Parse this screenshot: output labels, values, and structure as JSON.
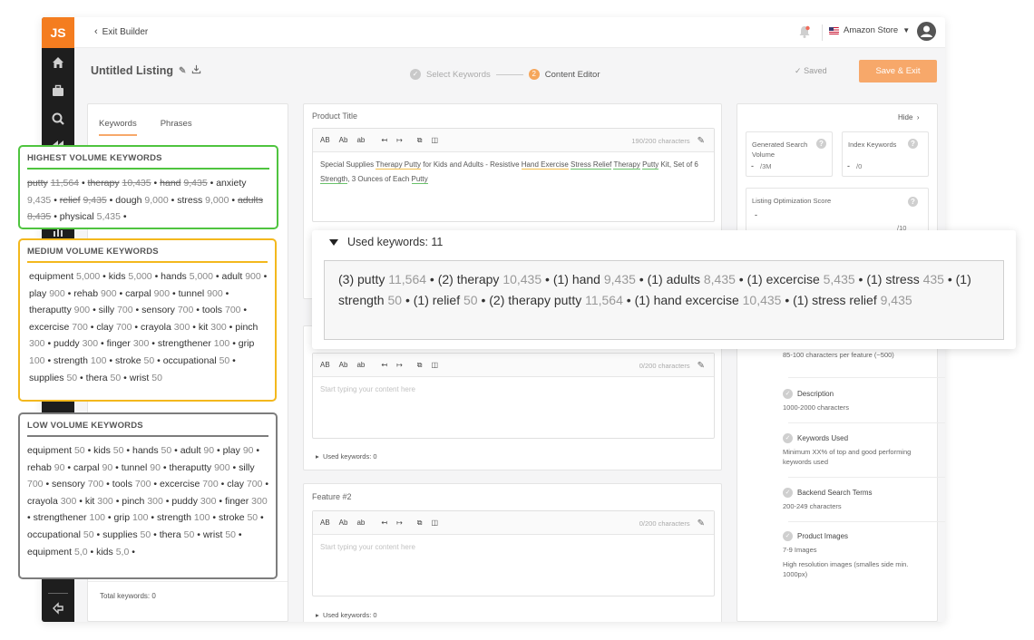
{
  "logo": "JS",
  "topbar": {
    "exit_label": "Exit Builder",
    "store_label": "Amazon Store"
  },
  "header": {
    "listing_title": "Untitled Listing",
    "step1_label": "Select Keywords",
    "step2_number": "2",
    "step2_label": "Content Editor",
    "saved_label": "Saved",
    "save_exit_label": "Save & Exit"
  },
  "left_panel": {
    "tab_keywords": "Keywords",
    "tab_phrases": "Phrases",
    "total_keywords": "Total keywords: 0"
  },
  "editor": {
    "product_title_label": "Product Title",
    "format_buttons": [
      "AB",
      "Ab",
      "ab"
    ],
    "product_title_counter": "190/200 characters",
    "product_title_text": [
      {
        "t": "Special Supplies ",
        "u": ""
      },
      {
        "t": "Therapy Putty",
        "u": "y"
      },
      {
        "t": " for Kids and Adults - Resistive ",
        "u": ""
      },
      {
        "t": "Hand Exercise",
        "u": "y"
      },
      {
        "t": " ",
        "u": ""
      },
      {
        "t": "Stress Relief",
        "u": "g"
      },
      {
        "t": " ",
        "u": ""
      },
      {
        "t": "Therapy",
        "u": "g"
      },
      {
        "t": " ",
        "u": ""
      },
      {
        "t": "Putty",
        "u": "g"
      },
      {
        "t": " Kit, Set of 6 ",
        "u": ""
      },
      {
        "t": "Strength",
        "u": "g"
      },
      {
        "t": ", 3 Ounces of Each ",
        "u": ""
      },
      {
        "t": "Putty",
        "u": "g"
      }
    ],
    "feature1_counter": "0/200 characters",
    "feature1_placeholder": "Start typing your content here",
    "feature1_used": "Used keywords: 0",
    "feature2_label": "Feature #2",
    "feature2_counter": "0/200 characters",
    "feature2_placeholder": "Start typing your content here",
    "feature2_used": "Used keywords: 0"
  },
  "right_panel": {
    "hide_label": "Hide",
    "gen_search_label": "Generated Search Volume",
    "gen_search_value": "-",
    "gen_search_suffix": "/3M",
    "index_label": "Index Keywords",
    "index_value": "-",
    "index_suffix": "/0",
    "score_label": "Listing Optimization Score",
    "score_value": "-",
    "score_suffix": "/10",
    "features_sub": "85-100 characters per feature (~500)",
    "features_dash": "-",
    "requirements": [
      {
        "title": "Description",
        "sub": "1000-2000 characters",
        "dash": "-"
      },
      {
        "title": "Keywords Used",
        "sub": "Minimum XX% of top and good performing keywords used",
        "dash": "-"
      },
      {
        "title": "Backend Search Terms",
        "sub": "200-249 characters",
        "dash": "-"
      },
      {
        "title": "Product Images",
        "sub": "7-9 Images",
        "dash": "-"
      }
    ],
    "images_extra": "High resolution images (smalles side min. 1000px)",
    "images_extra_dash": "-"
  },
  "keyword_boxes": {
    "high": {
      "title": "HIGHEST VOLUME KEYWORDS",
      "items": [
        {
          "w": "putty",
          "n": "11,564",
          "s": true
        },
        {
          "w": "therapy",
          "n": "10,435",
          "s": true
        },
        {
          "w": "hand",
          "n": "9,435",
          "s": true
        },
        {
          "w": "anxiety",
          "n": "9,435",
          "s": false
        },
        {
          "w": "relief",
          "n": "9,435",
          "s": true
        },
        {
          "w": "dough",
          "n": "9,000",
          "s": false
        },
        {
          "w": "stress",
          "n": "9,000",
          "s": false
        },
        {
          "w": "adults",
          "n": "8,435",
          "s": true
        },
        {
          "w": "physical",
          "n": "5,435",
          "s": false
        }
      ]
    },
    "medium": {
      "title": "MEDIUM VOLUME KEYWORDS",
      "items": [
        {
          "w": "equipment",
          "n": "5,000"
        },
        {
          "w": "kids",
          "n": "5,000"
        },
        {
          "w": "hands",
          "n": "5,000"
        },
        {
          "w": "adult",
          "n": "900"
        },
        {
          "w": "play",
          "n": "900"
        },
        {
          "w": "rehab",
          "n": "900"
        },
        {
          "w": "carpal",
          "n": "900"
        },
        {
          "w": "tunnel",
          "n": "900"
        },
        {
          "w": "theraputty",
          "n": "900"
        },
        {
          "w": "silly",
          "n": "700"
        },
        {
          "w": "sensory",
          "n": "700"
        },
        {
          "w": "tools",
          "n": "700"
        },
        {
          "w": "excercise",
          "n": "700"
        },
        {
          "w": "clay",
          "n": "700"
        },
        {
          "w": "crayola",
          "n": "300"
        },
        {
          "w": "kit",
          "n": "300"
        },
        {
          "w": "pinch",
          "n": "300"
        },
        {
          "w": "puddy",
          "n": "300"
        },
        {
          "w": "finger",
          "n": "300"
        },
        {
          "w": "strengthener",
          "n": "100"
        },
        {
          "w": "grip",
          "n": "100"
        },
        {
          "w": "strength",
          "n": "100"
        },
        {
          "w": "stroke",
          "n": "50"
        },
        {
          "w": "occupational",
          "n": "50"
        },
        {
          "w": "supplies",
          "n": "50"
        },
        {
          "w": "thera",
          "n": "50"
        },
        {
          "w": "wrist",
          "n": "50"
        }
      ]
    },
    "low": {
      "title": "LOW VOLUME KEYWORDS",
      "items": [
        {
          "w": "equipment",
          "n": "50"
        },
        {
          "w": "kids",
          "n": "50"
        },
        {
          "w": "hands",
          "n": "50"
        },
        {
          "w": "adult",
          "n": "90"
        },
        {
          "w": "play",
          "n": "90"
        },
        {
          "w": "rehab",
          "n": "90"
        },
        {
          "w": "carpal",
          "n": "90"
        },
        {
          "w": "tunnel",
          "n": "90"
        },
        {
          "w": "theraputty",
          "n": "900"
        },
        {
          "w": "silly",
          "n": "700"
        },
        {
          "w": "sensory",
          "n": "700"
        },
        {
          "w": "tools",
          "n": "700"
        },
        {
          "w": "excercise",
          "n": "700"
        },
        {
          "w": "clay",
          "n": "700"
        },
        {
          "w": "crayola",
          "n": "300"
        },
        {
          "w": "kit",
          "n": "300"
        },
        {
          "w": "pinch",
          "n": "300"
        },
        {
          "w": "puddy",
          "n": "300"
        },
        {
          "w": "finger",
          "n": "300"
        },
        {
          "w": "strengthener",
          "n": "100"
        },
        {
          "w": "grip",
          "n": "100"
        },
        {
          "w": "strength",
          "n": "100"
        },
        {
          "w": "stroke",
          "n": "50"
        },
        {
          "w": "occupational",
          "n": "50"
        },
        {
          "w": "supplies",
          "n": "50"
        },
        {
          "w": "thera",
          "n": "50"
        },
        {
          "w": "wrist",
          "n": "50"
        },
        {
          "w": "equipment",
          "n": "5,0"
        },
        {
          "w": "kids",
          "n": "5,0"
        }
      ]
    }
  },
  "popover": {
    "title": "Used keywords: 11",
    "items": [
      {
        "c": "(3) putty",
        "n": "11,564"
      },
      {
        "c": "(2) therapy",
        "n": "10,435"
      },
      {
        "c": "(1) hand",
        "n": "9,435"
      },
      {
        "c": "(1) adults",
        "n": "8,435"
      },
      {
        "c": "(1) excercise",
        "n": "5,435"
      },
      {
        "c": "(1) stress",
        "n": "435"
      },
      {
        "c": "(1) strength",
        "n": "50"
      },
      {
        "c": "(1) relief",
        "n": "50"
      },
      {
        "c": "(2) therapy putty",
        "n": "11,564"
      },
      {
        "c": "(1) hand excercise",
        "n": "10,435"
      },
      {
        "c": "(1) stress relief",
        "n": "9,435"
      }
    ]
  },
  "colors": {
    "brand": "#f47d20",
    "save_button": "#f7a86a",
    "high": "#4fc43f",
    "medium": "#f3b81d",
    "low": "#7d7d7d"
  },
  "icons": [
    "home-icon",
    "briefcase-icon",
    "search-icon",
    "rewind-icon",
    "bar-chart-icon",
    "logout-icon",
    "bell-icon",
    "avatar-icon",
    "pencil-icon",
    "download-icon",
    "undo-icon",
    "redo-icon",
    "copy-icon",
    "columns-icon",
    "help-icon",
    "chevron-right-icon"
  ]
}
